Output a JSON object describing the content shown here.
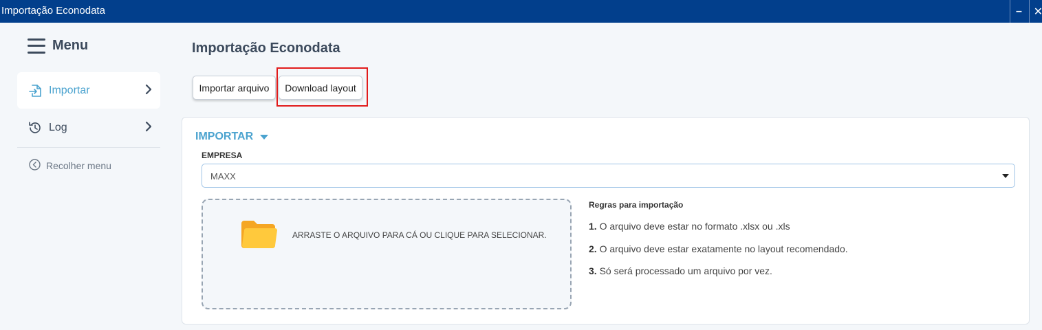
{
  "window": {
    "title": "Importação Econodata",
    "minimize_symbol": "–",
    "close_symbol": "✕"
  },
  "sidebar": {
    "menu_label": "Menu",
    "items": [
      {
        "label": "Importar",
        "icon": "file-import-icon",
        "active": true
      },
      {
        "label": "Log",
        "icon": "history-icon",
        "active": false
      }
    ],
    "collapse_label": "Recolher menu"
  },
  "main": {
    "page_title": "Importação Econodata",
    "buttons": {
      "import_label": "Importar arquivo",
      "download_label": "Download layout"
    },
    "section": {
      "title": "IMPORTAR",
      "company_label": "EMPRESA",
      "company_value": "MAXX",
      "dropzone_text": "ARRASTE O ARQUIVO PARA CÁ OU CLIQUE PARA SELECIONAR.",
      "rules_title": "Regras para importação",
      "rules": [
        {
          "num": "1.",
          "text": "O arquivo deve estar no formato .xlsx ou .xls"
        },
        {
          "num": "2.",
          "text": "O arquivo deve estar exatamente no layout recomendado."
        },
        {
          "num": "3.",
          "text": "Só será processado um arquivo por vez."
        }
      ]
    }
  },
  "colors": {
    "titlebar": "#023f8c",
    "accent": "#4ba3cf",
    "highlight": "#e11b1b",
    "folder": "#f5a623"
  }
}
